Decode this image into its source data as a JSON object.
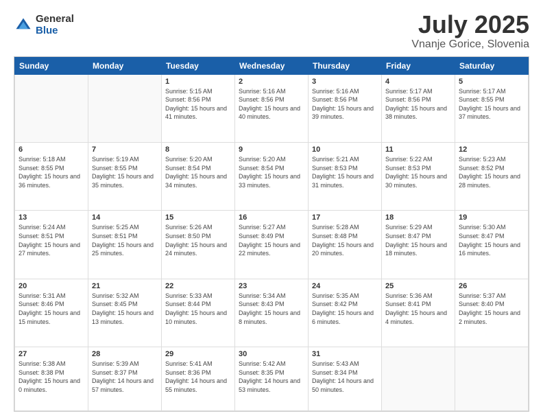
{
  "logo": {
    "general": "General",
    "blue": "Blue"
  },
  "title": "July 2025",
  "subtitle": "Vnanje Gorice, Slovenia",
  "headers": [
    "Sunday",
    "Monday",
    "Tuesday",
    "Wednesday",
    "Thursday",
    "Friday",
    "Saturday"
  ],
  "weeks": [
    [
      {
        "num": "",
        "sunrise": "",
        "sunset": "",
        "daylight": ""
      },
      {
        "num": "",
        "sunrise": "",
        "sunset": "",
        "daylight": ""
      },
      {
        "num": "1",
        "sunrise": "Sunrise: 5:15 AM",
        "sunset": "Sunset: 8:56 PM",
        "daylight": "Daylight: 15 hours and 41 minutes."
      },
      {
        "num": "2",
        "sunrise": "Sunrise: 5:16 AM",
        "sunset": "Sunset: 8:56 PM",
        "daylight": "Daylight: 15 hours and 40 minutes."
      },
      {
        "num": "3",
        "sunrise": "Sunrise: 5:16 AM",
        "sunset": "Sunset: 8:56 PM",
        "daylight": "Daylight: 15 hours and 39 minutes."
      },
      {
        "num": "4",
        "sunrise": "Sunrise: 5:17 AM",
        "sunset": "Sunset: 8:56 PM",
        "daylight": "Daylight: 15 hours and 38 minutes."
      },
      {
        "num": "5",
        "sunrise": "Sunrise: 5:17 AM",
        "sunset": "Sunset: 8:55 PM",
        "daylight": "Daylight: 15 hours and 37 minutes."
      }
    ],
    [
      {
        "num": "6",
        "sunrise": "Sunrise: 5:18 AM",
        "sunset": "Sunset: 8:55 PM",
        "daylight": "Daylight: 15 hours and 36 minutes."
      },
      {
        "num": "7",
        "sunrise": "Sunrise: 5:19 AM",
        "sunset": "Sunset: 8:55 PM",
        "daylight": "Daylight: 15 hours and 35 minutes."
      },
      {
        "num": "8",
        "sunrise": "Sunrise: 5:20 AM",
        "sunset": "Sunset: 8:54 PM",
        "daylight": "Daylight: 15 hours and 34 minutes."
      },
      {
        "num": "9",
        "sunrise": "Sunrise: 5:20 AM",
        "sunset": "Sunset: 8:54 PM",
        "daylight": "Daylight: 15 hours and 33 minutes."
      },
      {
        "num": "10",
        "sunrise": "Sunrise: 5:21 AM",
        "sunset": "Sunset: 8:53 PM",
        "daylight": "Daylight: 15 hours and 31 minutes."
      },
      {
        "num": "11",
        "sunrise": "Sunrise: 5:22 AM",
        "sunset": "Sunset: 8:53 PM",
        "daylight": "Daylight: 15 hours and 30 minutes."
      },
      {
        "num": "12",
        "sunrise": "Sunrise: 5:23 AM",
        "sunset": "Sunset: 8:52 PM",
        "daylight": "Daylight: 15 hours and 28 minutes."
      }
    ],
    [
      {
        "num": "13",
        "sunrise": "Sunrise: 5:24 AM",
        "sunset": "Sunset: 8:51 PM",
        "daylight": "Daylight: 15 hours and 27 minutes."
      },
      {
        "num": "14",
        "sunrise": "Sunrise: 5:25 AM",
        "sunset": "Sunset: 8:51 PM",
        "daylight": "Daylight: 15 hours and 25 minutes."
      },
      {
        "num": "15",
        "sunrise": "Sunrise: 5:26 AM",
        "sunset": "Sunset: 8:50 PM",
        "daylight": "Daylight: 15 hours and 24 minutes."
      },
      {
        "num": "16",
        "sunrise": "Sunrise: 5:27 AM",
        "sunset": "Sunset: 8:49 PM",
        "daylight": "Daylight: 15 hours and 22 minutes."
      },
      {
        "num": "17",
        "sunrise": "Sunrise: 5:28 AM",
        "sunset": "Sunset: 8:48 PM",
        "daylight": "Daylight: 15 hours and 20 minutes."
      },
      {
        "num": "18",
        "sunrise": "Sunrise: 5:29 AM",
        "sunset": "Sunset: 8:47 PM",
        "daylight": "Daylight: 15 hours and 18 minutes."
      },
      {
        "num": "19",
        "sunrise": "Sunrise: 5:30 AM",
        "sunset": "Sunset: 8:47 PM",
        "daylight": "Daylight: 15 hours and 16 minutes."
      }
    ],
    [
      {
        "num": "20",
        "sunrise": "Sunrise: 5:31 AM",
        "sunset": "Sunset: 8:46 PM",
        "daylight": "Daylight: 15 hours and 15 minutes."
      },
      {
        "num": "21",
        "sunrise": "Sunrise: 5:32 AM",
        "sunset": "Sunset: 8:45 PM",
        "daylight": "Daylight: 15 hours and 13 minutes."
      },
      {
        "num": "22",
        "sunrise": "Sunrise: 5:33 AM",
        "sunset": "Sunset: 8:44 PM",
        "daylight": "Daylight: 15 hours and 10 minutes."
      },
      {
        "num": "23",
        "sunrise": "Sunrise: 5:34 AM",
        "sunset": "Sunset: 8:43 PM",
        "daylight": "Daylight: 15 hours and 8 minutes."
      },
      {
        "num": "24",
        "sunrise": "Sunrise: 5:35 AM",
        "sunset": "Sunset: 8:42 PM",
        "daylight": "Daylight: 15 hours and 6 minutes."
      },
      {
        "num": "25",
        "sunrise": "Sunrise: 5:36 AM",
        "sunset": "Sunset: 8:41 PM",
        "daylight": "Daylight: 15 hours and 4 minutes."
      },
      {
        "num": "26",
        "sunrise": "Sunrise: 5:37 AM",
        "sunset": "Sunset: 8:40 PM",
        "daylight": "Daylight: 15 hours and 2 minutes."
      }
    ],
    [
      {
        "num": "27",
        "sunrise": "Sunrise: 5:38 AM",
        "sunset": "Sunset: 8:38 PM",
        "daylight": "Daylight: 15 hours and 0 minutes."
      },
      {
        "num": "28",
        "sunrise": "Sunrise: 5:39 AM",
        "sunset": "Sunset: 8:37 PM",
        "daylight": "Daylight: 14 hours and 57 minutes."
      },
      {
        "num": "29",
        "sunrise": "Sunrise: 5:41 AM",
        "sunset": "Sunset: 8:36 PM",
        "daylight": "Daylight: 14 hours and 55 minutes."
      },
      {
        "num": "30",
        "sunrise": "Sunrise: 5:42 AM",
        "sunset": "Sunset: 8:35 PM",
        "daylight": "Daylight: 14 hours and 53 minutes."
      },
      {
        "num": "31",
        "sunrise": "Sunrise: 5:43 AM",
        "sunset": "Sunset: 8:34 PM",
        "daylight": "Daylight: 14 hours and 50 minutes."
      },
      {
        "num": "",
        "sunrise": "",
        "sunset": "",
        "daylight": ""
      },
      {
        "num": "",
        "sunrise": "",
        "sunset": "",
        "daylight": ""
      }
    ]
  ]
}
